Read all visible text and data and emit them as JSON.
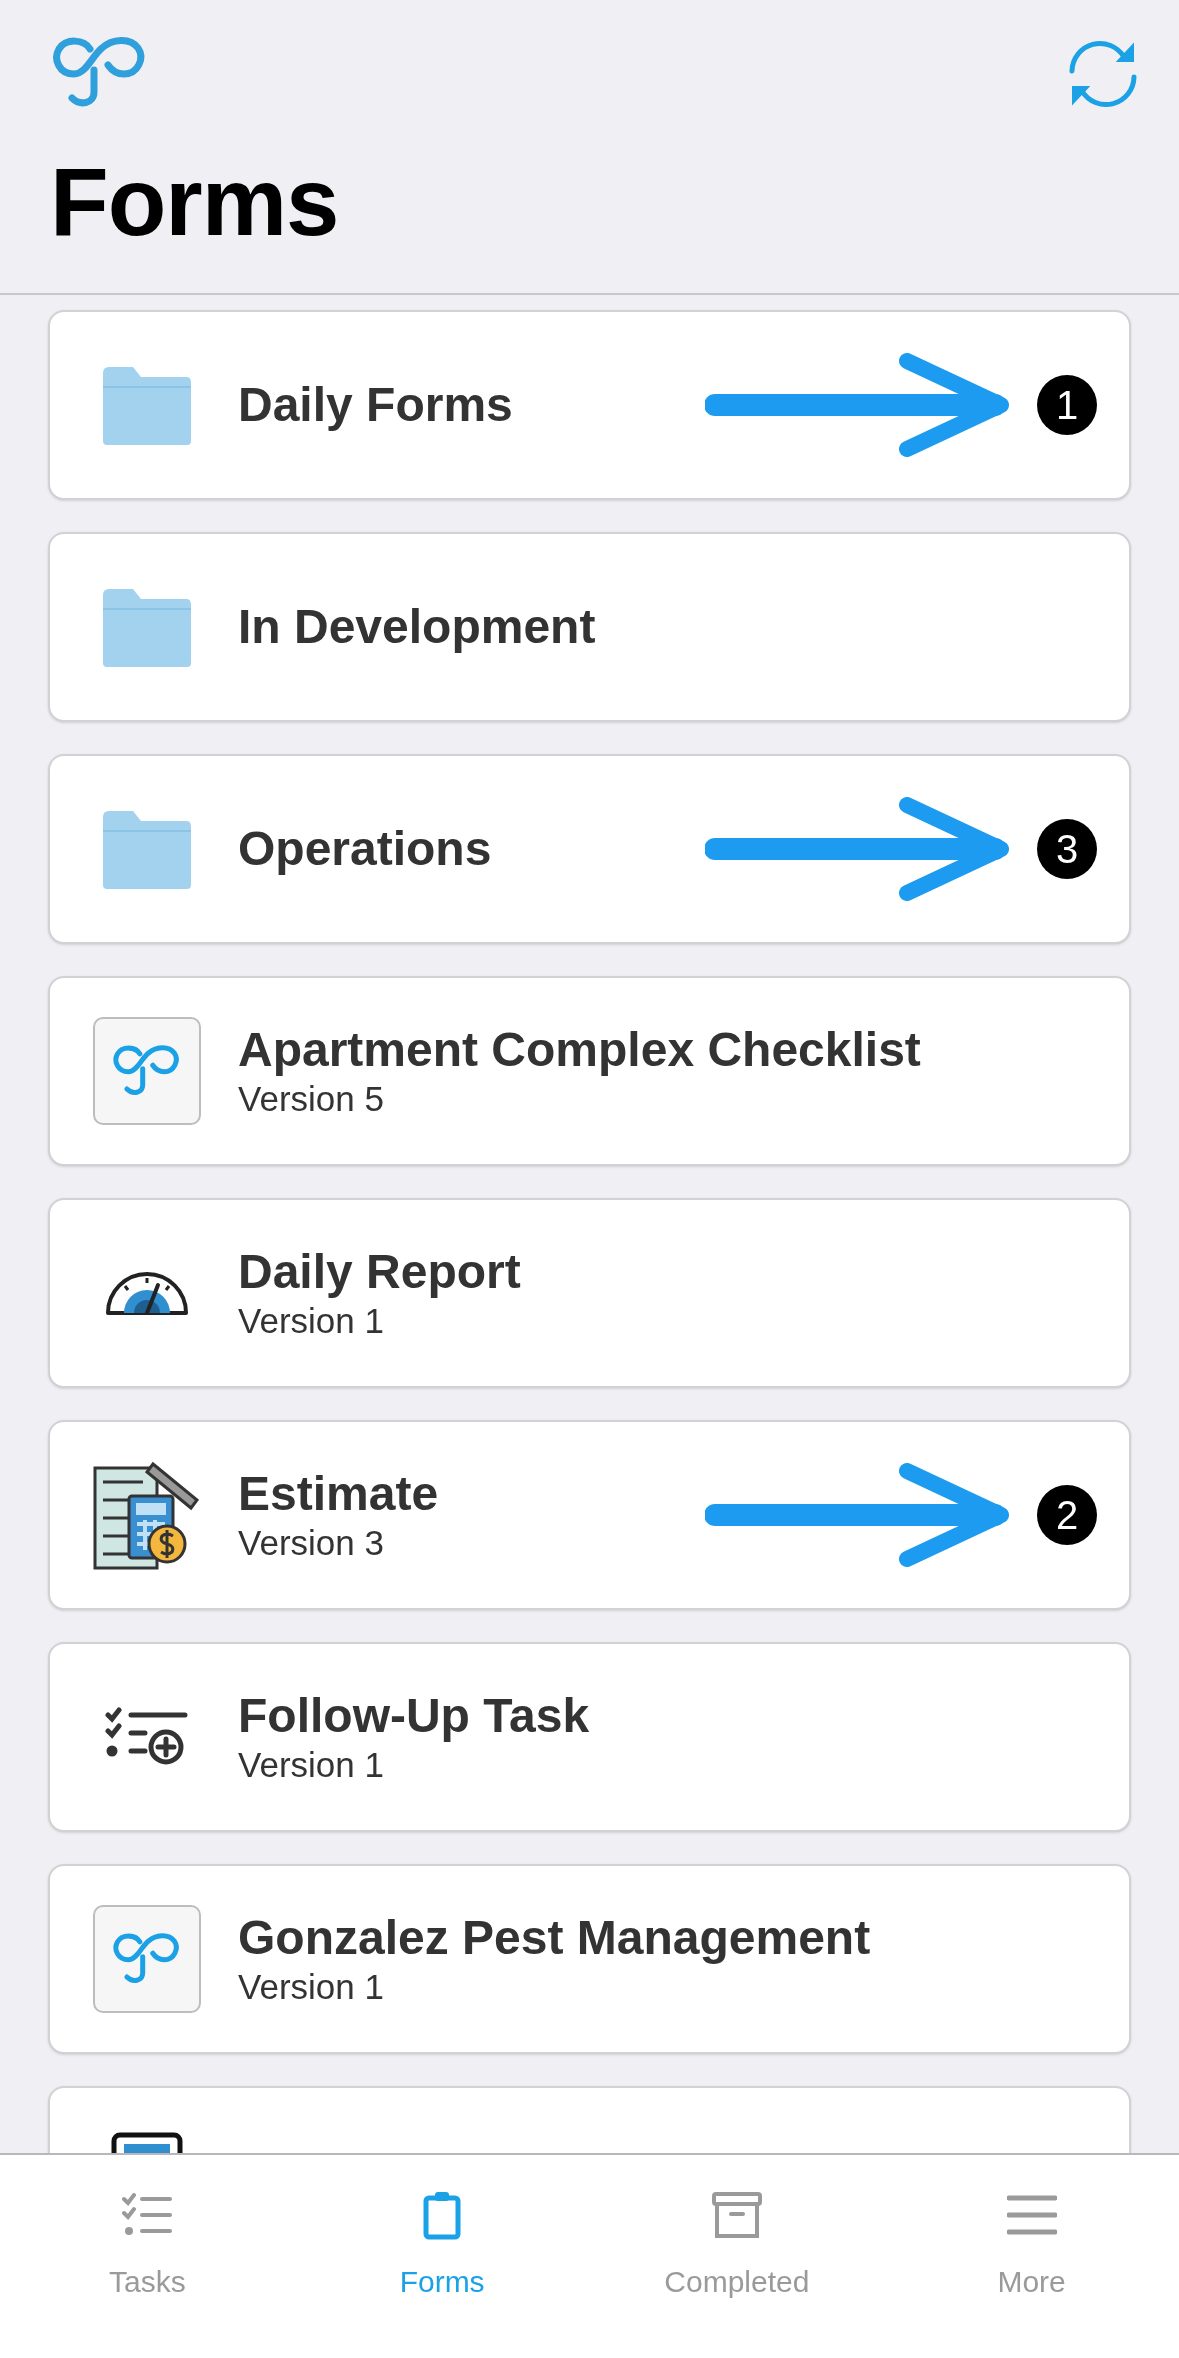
{
  "header": {
    "title": "Forms"
  },
  "items": [
    {
      "kind": "folder",
      "title": "Daily Forms",
      "annotation": "1"
    },
    {
      "kind": "folder",
      "title": "In Development"
    },
    {
      "kind": "folder",
      "title": "Operations",
      "annotation": "3"
    },
    {
      "kind": "app",
      "title": "Apartment Complex Checklist",
      "version": "Version 5"
    },
    {
      "kind": "gauge",
      "title": "Daily Report",
      "version": "Version 1"
    },
    {
      "kind": "estimate",
      "title": "Estimate",
      "version": "Version 3",
      "annotation": "2"
    },
    {
      "kind": "checklist",
      "title": "Follow-Up Task",
      "version": "Version 1"
    },
    {
      "kind": "app",
      "title": "Gonzalez Pest Management",
      "version": "Version 1"
    },
    {
      "kind": "monitor"
    }
  ],
  "tabs": [
    {
      "kind": "tasks",
      "label": "Tasks",
      "selected": false
    },
    {
      "kind": "forms",
      "label": "Forms",
      "selected": true
    },
    {
      "kind": "completed",
      "label": "Completed",
      "selected": false
    },
    {
      "kind": "more",
      "label": "More",
      "selected": false
    }
  ]
}
